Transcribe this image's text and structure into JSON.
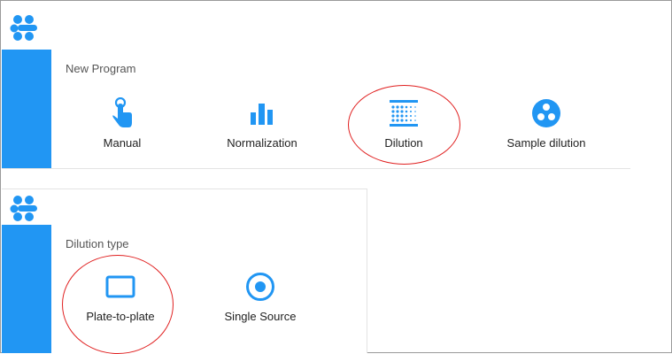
{
  "colors": {
    "accent": "#2196f3",
    "annotation": "#e02020",
    "text": "#222222",
    "muted": "#555555"
  },
  "new_program": {
    "title": "New Program",
    "items": [
      {
        "label": "Manual",
        "icon": "hand-pointer-icon"
      },
      {
        "label": "Normalization",
        "icon": "bar-chart-icon"
      },
      {
        "label": "Dilution",
        "icon": "dilution-grid-icon"
      },
      {
        "label": "Sample dilution",
        "icon": "three-dots-circle-icon"
      }
    ]
  },
  "dilution_type": {
    "title": "Dilution type",
    "items": [
      {
        "label": "Plate-to-plate",
        "icon": "rectangle-outline-icon"
      },
      {
        "label": "Single Source",
        "icon": "target-circle-icon"
      }
    ]
  }
}
